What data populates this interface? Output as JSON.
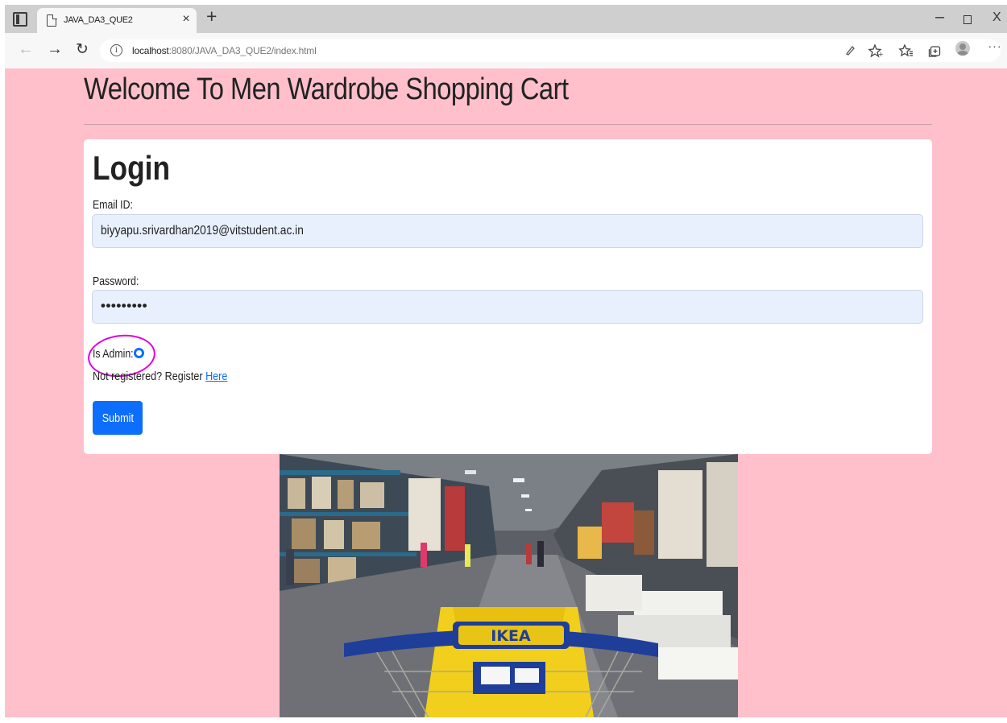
{
  "browser": {
    "tab_title": "JAVA_DA3_QUE2",
    "tab_close": "×",
    "new_tab": "+",
    "url_host": "localhost",
    "url_rest": ":8080/JAVA_DA3_QUE2/index.html",
    "window_controls": {
      "minimize": "–",
      "close": "X"
    },
    "icons": [
      "tab-actions-icon",
      "page-icon",
      "back-icon",
      "forward-icon",
      "reload-icon",
      "info-icon",
      "read-aloud-icon",
      "favorites-add-icon",
      "favorites-icon",
      "collections-icon",
      "profile-icon",
      "more-icon"
    ]
  },
  "page": {
    "heading": "Welcome To Men Wardrobe Shopping Cart",
    "login": {
      "title": "Login",
      "email_label": "Email ID:",
      "email_value": "biyyapu.srivardhan2019@vitstudent.ac.in",
      "password_label": "Password:",
      "password_value": "•••••••••",
      "admin_label": "Is Admin:",
      "register_text": "Not registered? Register ",
      "register_link": "Here",
      "submit_label": "Submit"
    },
    "photo": {
      "cart_text": "IKEA"
    }
  },
  "colors": {
    "page_background": "#ffc0cb",
    "primary": "#0d6efd",
    "input_background": "#e8f0fe",
    "annotation": "#e000e0"
  }
}
